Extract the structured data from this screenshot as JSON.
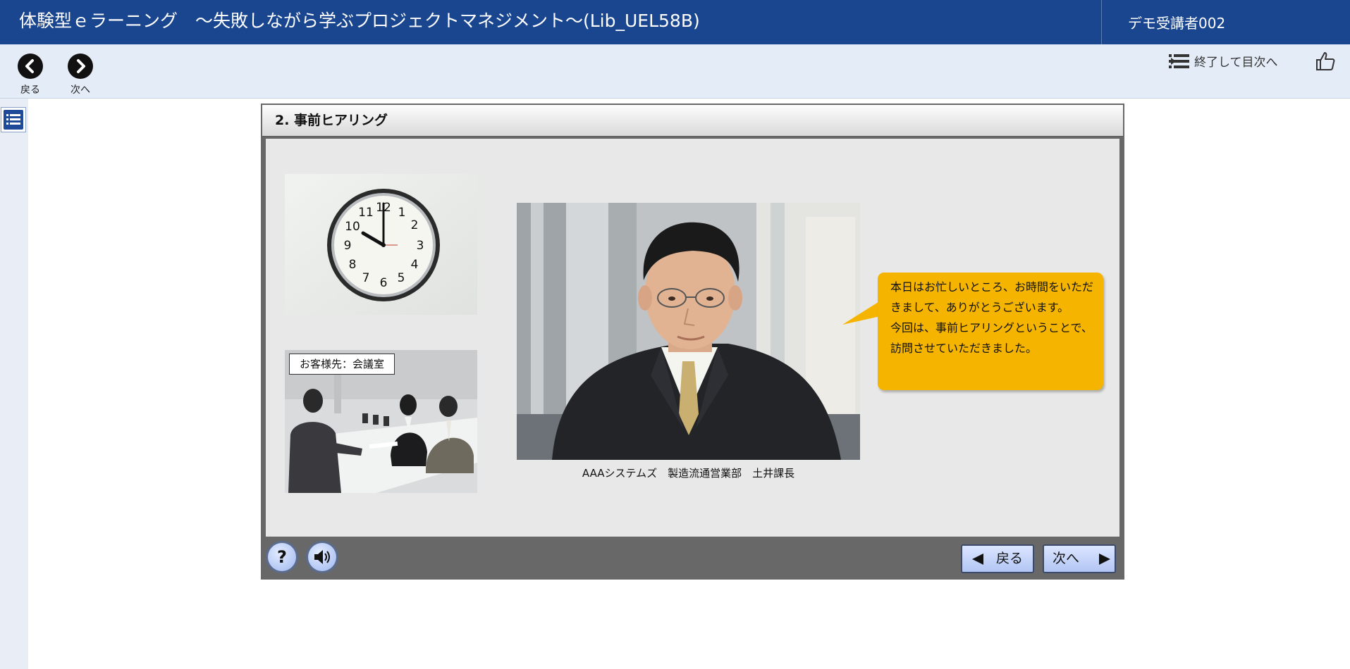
{
  "header": {
    "title": "体験型ｅラーニング　～失敗しながら学ぶプロジェクトマネジメント～(Lib_UEL58B)",
    "user": "デモ受講者002",
    "bg_color": "#1a4690"
  },
  "toolbar": {
    "prev_label": "戻る",
    "next_label": "次へ",
    "exit_toc_label": "終了して目次へ",
    "icons": [
      "chevron-left-icon",
      "chevron-right-icon",
      "exit-list-icon",
      "thumbs-up-icon"
    ]
  },
  "sidebar": {
    "toc_icon": "list-icon"
  },
  "slide": {
    "title": "2.  事前ヒアリング",
    "meeting_tag": "お客様先：会議室",
    "caption": "AAAシステムズ　製造流通営業部　土井課長",
    "speech_lines": [
      "本日はお忙しいところ、お時間をいただきまして、ありがとうございます。",
      "今回は、事前ヒアリングということで、訪問させていただきました。"
    ],
    "bubble_color": "#f5b400"
  },
  "bottom_bar": {
    "help_label": "?",
    "back_label": "戻る",
    "next_label": "次へ",
    "icons": [
      "help-icon",
      "speaker-icon",
      "triangle-left-icon",
      "triangle-right-icon"
    ]
  }
}
